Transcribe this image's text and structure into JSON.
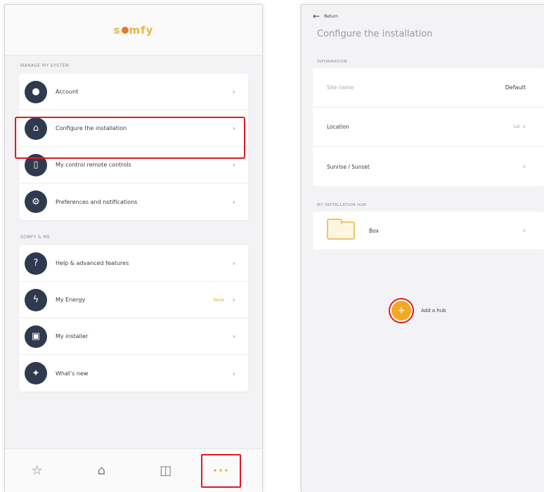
{
  "left": {
    "logo": {
      "pre": "s",
      "post": "mfy"
    },
    "section1_label": "Manage my system",
    "menu1": [
      {
        "label": "Account",
        "icon": "user-icon",
        "glyph": "●"
      },
      {
        "label": "Configure the installation",
        "icon": "home-icon",
        "glyph": "⌂"
      },
      {
        "label": "My control remote controls",
        "icon": "remote-icon",
        "glyph": "▯"
      },
      {
        "label": "Preferences and notifications",
        "icon": "gear-icon",
        "glyph": "⚙"
      }
    ],
    "section2_label": "Somfy & me",
    "menu2": [
      {
        "label": "Help & advanced features",
        "icon": "help-icon",
        "glyph": "?",
        "badge": ""
      },
      {
        "label": "My Energy",
        "icon": "energy-icon",
        "glyph": "ϟ",
        "badge": "New"
      },
      {
        "label": "My installer",
        "icon": "installer-icon",
        "glyph": "▣",
        "badge": ""
      },
      {
        "label": "What's new",
        "icon": "gift-icon",
        "glyph": "✦",
        "badge": ""
      }
    ],
    "chevron": "›",
    "tabs": [
      {
        "name": "favorites-tab",
        "icon": "star-icon",
        "glyph": "☆"
      },
      {
        "name": "home-tab",
        "icon": "home-icon",
        "glyph": "⌂"
      },
      {
        "name": "devices-tab",
        "icon": "devices-icon",
        "glyph": "◫"
      }
    ],
    "more_tab_glyph": "•••"
  },
  "right": {
    "back_label": "Return",
    "back_glyph": "←",
    "title": "Configure the installation",
    "section1_label": "Information",
    "site_name_label": "Site name",
    "site_name_value": "Default",
    "location_label": "Location",
    "location_value": "Set",
    "sunrise_label": "Sunrise / Sunset",
    "section2_label": "My installation hub",
    "hub_name": "Box",
    "add_hub_label": "Add a hub",
    "add_glyph": "+"
  },
  "colors": {
    "accent": "#f2a823",
    "highlight": "#e01a22",
    "icon_bg": "#2f3a4e"
  }
}
